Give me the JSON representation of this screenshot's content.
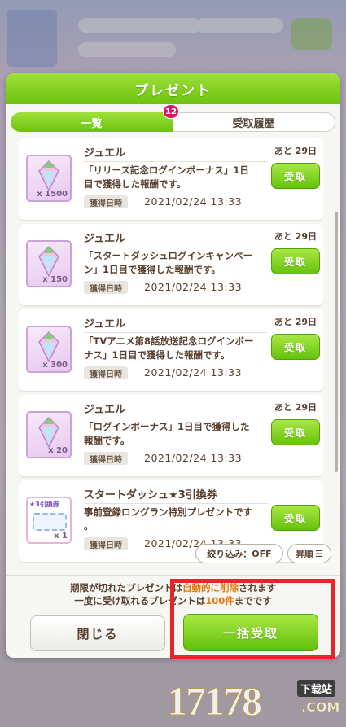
{
  "dialog": {
    "title": "プレゼント",
    "tabs": {
      "list_label": "一覧",
      "history_label": "受取履歴",
      "badge_count": "12"
    }
  },
  "item_date_label": "獲得日時",
  "receive_label": "受取",
  "items": [
    {
      "name": "ジュエル",
      "quantity": "x 1500",
      "remaining": "あと 29日",
      "desc_line1": "「リリース記念ログインボーナス」1日",
      "desc_line2": "目で獲得した報酬です。",
      "date": "2021/02/24 13:33"
    },
    {
      "name": "ジュエル",
      "quantity": "x 150",
      "remaining": "あと 29日",
      "desc_line1": "「スタートダッシュログインキャンペー",
      "desc_line2": "ン」1日目で獲得した報酬です。",
      "date": "2021/02/24 13:33"
    },
    {
      "name": "ジュエル",
      "quantity": "x 300",
      "remaining": "あと 29日",
      "desc_line1": "「TVアニメ第8話放送記念ログインボー",
      "desc_line2": "ナス」1日目で獲得した報酬です。",
      "date": "2021/02/24 13:33"
    },
    {
      "name": "ジュエル",
      "quantity": "x 20",
      "remaining": "あと 29日",
      "desc_line1": "「ログインボーナス」1日目で獲得した",
      "desc_line2": "報酬です。",
      "date": "2021/02/24 13:33"
    },
    {
      "name": "スタートダッシュ★3引換券",
      "quantity": "x 1",
      "ticket_tag": "★3引換券",
      "desc_line1": "事前登録ロングラン特別プレゼントです",
      "desc_line2": "。",
      "date": "2021/02/24 13:33"
    }
  ],
  "filter": {
    "label": "絞り込み：OFF",
    "sort_label": "昇順"
  },
  "footer": {
    "notice_line1_a": "期限が切れたプレゼントは",
    "notice_line1_b": "自動的に削除",
    "notice_line1_c": "されます",
    "notice_line2_a": "一度に受け取れるプレゼントは",
    "notice_line2_b": "100件",
    "notice_line2_c": "までです",
    "close_label": "閉じる",
    "bulk_label": "一括受取"
  },
  "watermark": {
    "number": "17178",
    "tag": "下载站",
    "domain": ".COM"
  },
  "colors": {
    "accent_green": "#6cc20e",
    "badge_pink": "#e0156a",
    "highlight_red": "#e4262b",
    "text_brown": "#5a4030"
  }
}
